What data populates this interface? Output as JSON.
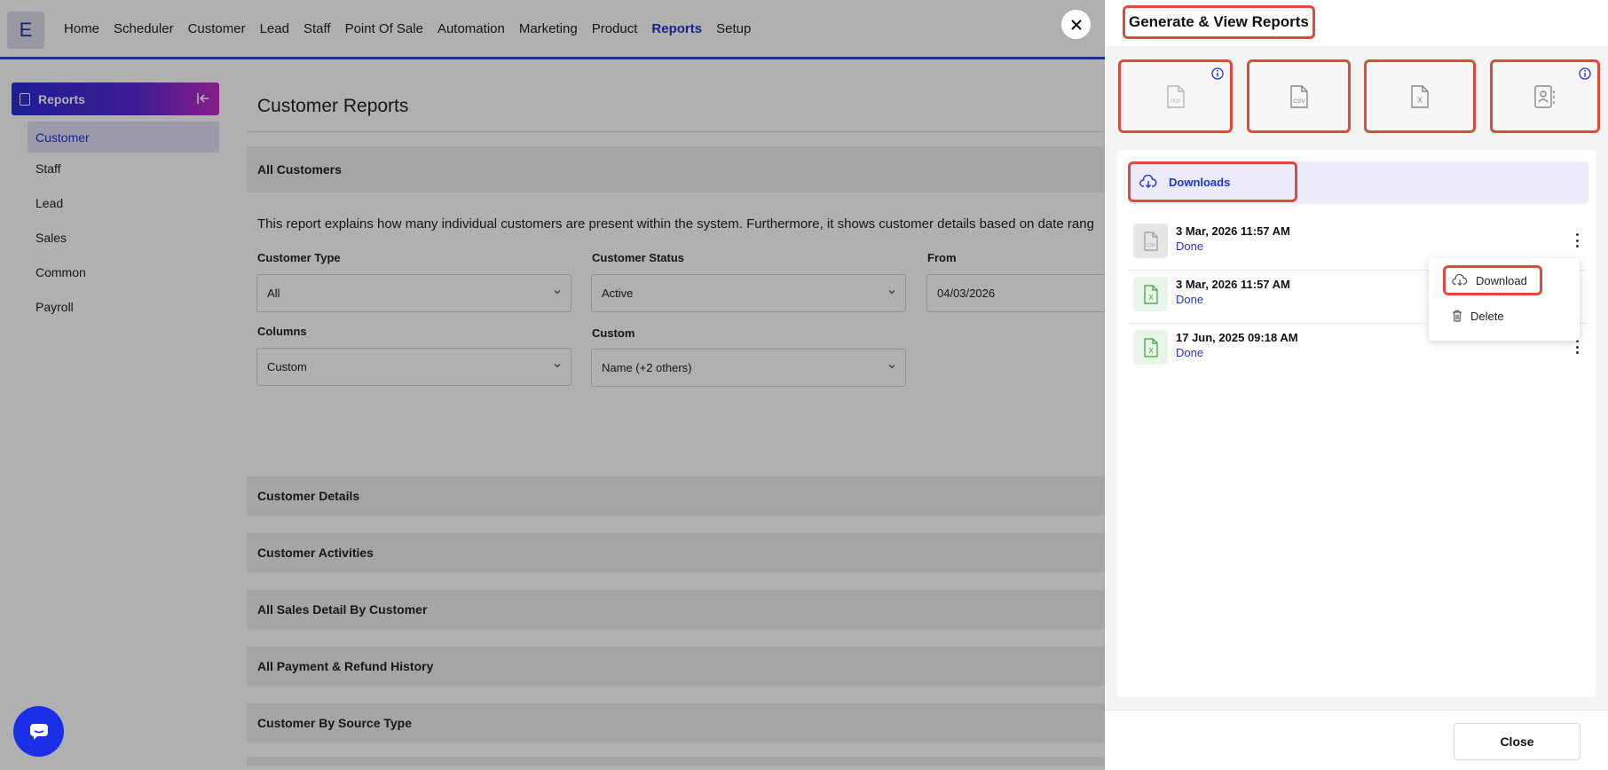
{
  "brand": {
    "logo_letter": "E"
  },
  "nav": {
    "items": [
      {
        "label": "Home",
        "active": false
      },
      {
        "label": "Scheduler",
        "active": false
      },
      {
        "label": "Customer",
        "active": false
      },
      {
        "label": "Lead",
        "active": false
      },
      {
        "label": "Staff",
        "active": false
      },
      {
        "label": "Point Of Sale",
        "active": false
      },
      {
        "label": "Automation",
        "active": false
      },
      {
        "label": "Marketing",
        "active": false
      },
      {
        "label": "Product",
        "active": false
      },
      {
        "label": "Reports",
        "active": true
      },
      {
        "label": "Setup",
        "active": false
      }
    ]
  },
  "sidebar": {
    "title": "Reports",
    "items": [
      {
        "label": "Customer",
        "active": true
      },
      {
        "label": "Staff",
        "active": false
      },
      {
        "label": "Lead",
        "active": false
      },
      {
        "label": "Sales",
        "active": false
      },
      {
        "label": "Common",
        "active": false
      },
      {
        "label": "Payroll",
        "active": false
      }
    ]
  },
  "main": {
    "title": "Customer Reports",
    "sections": {
      "all_customers": "All Customers",
      "customer_details": "Customer Details",
      "customer_activities": "Customer Activities",
      "sales_detail": "All Sales Detail By Customer",
      "payment_history": "All Payment & Refund History",
      "source_type": "Customer By Source Type"
    },
    "description": "This report explains how many individual customers are present within the system. Furthermore, it shows customer details based on date rang",
    "filters": {
      "customer_type": {
        "label": "Customer Type",
        "value": "All"
      },
      "customer_status": {
        "label": "Customer Status",
        "value": "Active"
      },
      "from": {
        "label": "From",
        "value": "04/03/2026"
      },
      "columns": {
        "label": "Columns",
        "value": "Custom"
      },
      "custom": {
        "label": "Custom",
        "value": "Name (+2 others)"
      }
    }
  },
  "drawer": {
    "title": "Generate & View Reports",
    "export_options": [
      {
        "icon": "pdf-file-icon",
        "text": "PDF",
        "has_info": true
      },
      {
        "icon": "csv-file-icon",
        "text": "CSV",
        "has_info": false
      },
      {
        "icon": "excel-file-icon",
        "text": "X",
        "has_info": false
      },
      {
        "icon": "contact-book-icon",
        "text": "",
        "has_info": true
      }
    ],
    "downloads_tab": "Downloads",
    "downloads": [
      {
        "type": "csv",
        "badge_text": "CSV",
        "time": "3 Mar, 2026 11:57 AM",
        "status": "Done"
      },
      {
        "type": "xls",
        "badge_text": "X",
        "time": "3 Mar, 2026 11:57 AM",
        "status": "Done"
      },
      {
        "type": "xls",
        "badge_text": "X",
        "time": "17 Jun, 2025 09:18 AM",
        "status": "Done"
      }
    ],
    "context_menu": {
      "download": "Download",
      "delete": "Delete"
    },
    "close_label": "Close"
  },
  "colors": {
    "accent": "#2433c9",
    "highlight": "#e04a3a",
    "chat": "#1b2fe8"
  }
}
